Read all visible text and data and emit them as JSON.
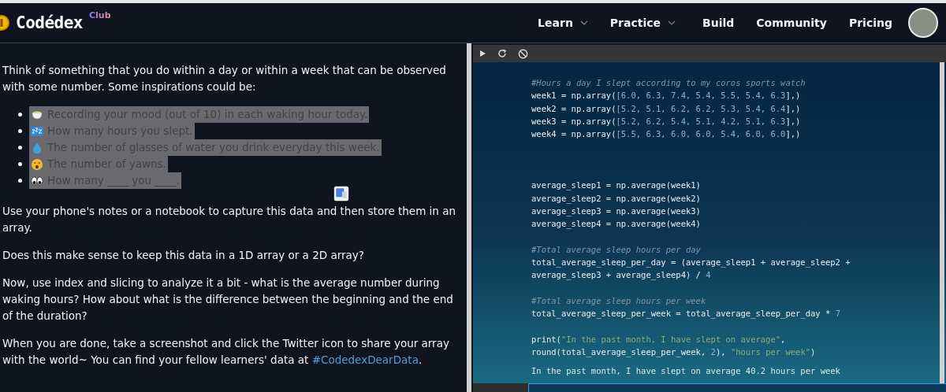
{
  "header": {
    "brand": "Codédex",
    "brand_badge": "Club",
    "nav": [
      {
        "label": "Learn",
        "dropdown": true
      },
      {
        "label": "Practice",
        "dropdown": true
      },
      {
        "label": "Build",
        "dropdown": false
      },
      {
        "label": "Community",
        "dropdown": false
      },
      {
        "label": "Pricing",
        "dropdown": false
      }
    ]
  },
  "lesson": {
    "intro": "Think of something that you do within a day or within a week that can be observed with some number. Some inspirations could be:",
    "list": [
      {
        "text": "Recording your mood (out of 10) in each waking hour today.",
        "highlighted": true
      },
      {
        "text": "How many hours you slept.",
        "highlighted": true
      },
      {
        "text": "The number of glasses of water you drink everyday this week.",
        "highlighted": true
      },
      {
        "text": "The number of yawns.",
        "highlighted": true
      },
      {
        "text": "How many ____ you ____.",
        "highlighted": true
      }
    ],
    "paragraphs": [
      {
        "text": "Use your phone's notes or a notebook to capture this data and then store them in an array."
      },
      {
        "text": "Does this make sense to keep this data in a 1D array or a 2D array?"
      },
      {
        "text": "Now, use index and slicing to analyze it a bit - what is the average number during waking hours? How about what is the difference between the beginning and the end of the duration?"
      },
      {
        "text": "When you are done, take a screenshot and click the Twitter icon to share your array with the world~ You can find your fellow learners' data at",
        "link": "#CodedexDearData",
        "after": "."
      }
    ]
  },
  "editor": {
    "code": [
      {
        "kind": "code",
        "tokens": [
          {
            "kind": "comment",
            "text": "#Hours a day I slept according to my coros sports watch"
          }
        ]
      },
      {
        "kind": "code",
        "tokens": [
          {
            "kind": "plain",
            "text": "week1 = np.array("
          },
          {
            "kind": "number",
            "text": "[6.0, 6.3, 7.4, 5.4, 5.5, 5.4, 6.3"
          },
          {
            "kind": "plain",
            "text": "],)"
          }
        ]
      },
      {
        "kind": "code",
        "tokens": [
          {
            "kind": "plain",
            "text": "week2 = np.array("
          },
          {
            "kind": "number",
            "text": "[5.2, 5.1, 6.2, 6.2, 5.3, 5.4, 6.4"
          },
          {
            "kind": "plain",
            "text": "],)"
          }
        ]
      },
      {
        "kind": "code",
        "tokens": [
          {
            "kind": "plain",
            "text": "week3 = np.array("
          },
          {
            "kind": "number",
            "text": "[5.2, 6.2, 5.4, 5.1, 4.2, 5.1, 6.3"
          },
          {
            "kind": "plain",
            "text": "],)"
          }
        ]
      },
      {
        "kind": "code",
        "tokens": [
          {
            "kind": "plain",
            "text": "week4 = np.array("
          },
          {
            "kind": "number",
            "text": "[5.5, 6.3, 6.0, 6.0, 5.4, 6.0, 6.0"
          },
          {
            "kind": "plain",
            "text": "],)"
          }
        ]
      },
      {
        "kind": "blank"
      },
      {
        "kind": "blank"
      },
      {
        "kind": "blank"
      },
      {
        "kind": "code",
        "tokens": [
          {
            "kind": "plain",
            "text": "average_sleep1 = np.average(week1)"
          }
        ]
      },
      {
        "kind": "code",
        "tokens": [
          {
            "kind": "plain",
            "text": "average_sleep2 = np.average(week2)"
          }
        ]
      },
      {
        "kind": "code",
        "tokens": [
          {
            "kind": "plain",
            "text": "average_sleep3 = np.average(week3)"
          }
        ]
      },
      {
        "kind": "code",
        "tokens": [
          {
            "kind": "plain",
            "text": "average_sleep4 = np.average(week4)"
          }
        ]
      },
      {
        "kind": "blank"
      },
      {
        "kind": "code",
        "tokens": [
          {
            "kind": "comment",
            "text": "#Total average sleep hours per day"
          }
        ]
      },
      {
        "kind": "code",
        "tokens": [
          {
            "kind": "plain",
            "text": "total_average_sleep_per_day = (average_sleep1 + average_sleep2 +"
          }
        ]
      },
      {
        "kind": "code",
        "tokens": [
          {
            "kind": "plain",
            "text": "average_sleep3 + average_sleep4) / "
          },
          {
            "kind": "number",
            "text": "4"
          }
        ]
      },
      {
        "kind": "blank"
      },
      {
        "kind": "code",
        "tokens": [
          {
            "kind": "comment",
            "text": "#Total average sleep hours per week"
          }
        ]
      },
      {
        "kind": "code",
        "tokens": [
          {
            "kind": "plain",
            "text": "total_average_sleep_per_week = total_average_sleep_per_day * "
          },
          {
            "kind": "number",
            "text": "7"
          }
        ]
      },
      {
        "kind": "blank"
      },
      {
        "kind": "code",
        "tokens": [
          {
            "kind": "plain",
            "text": "print("
          },
          {
            "kind": "string",
            "text": "\"In the past month, I have slept on average\""
          },
          {
            "kind": "plain",
            "text": ","
          }
        ]
      },
      {
        "kind": "code",
        "tokens": [
          {
            "kind": "plain",
            "text": "round(total_average_sleep_per_week, "
          },
          {
            "kind": "number",
            "text": "2"
          },
          {
            "kind": "plain",
            "text": "), "
          },
          {
            "kind": "string",
            "text": "\"hours per week\""
          },
          {
            "kind": "plain",
            "text": ")"
          }
        ]
      }
    ],
    "output": "In the past month, I have slept on average 40.2 hours per week"
  }
}
